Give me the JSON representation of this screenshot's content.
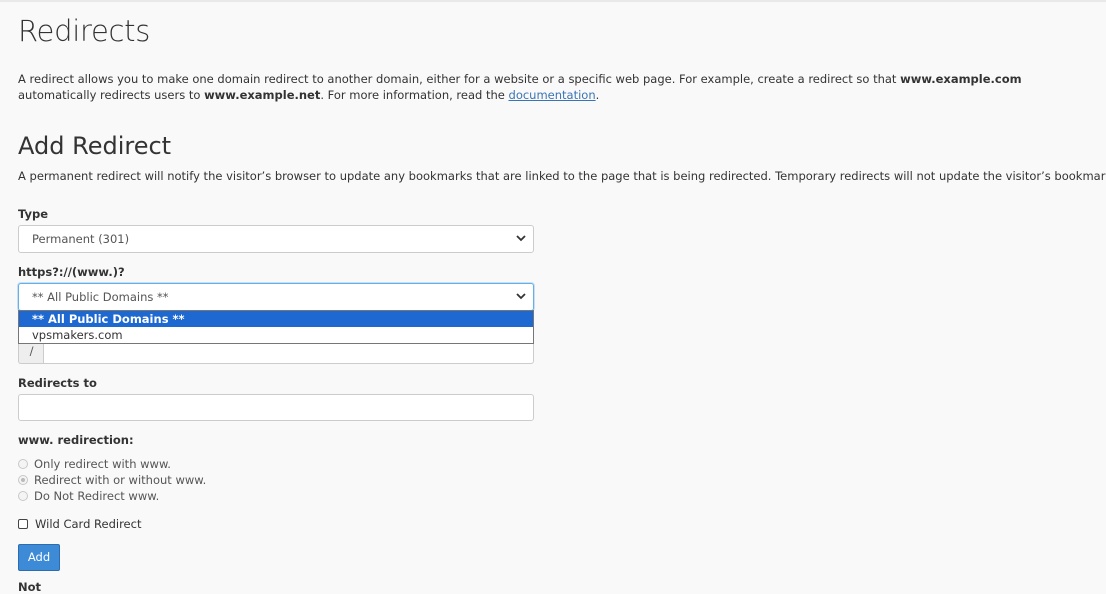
{
  "page": {
    "title": "Redirects",
    "intro": {
      "text1": "A redirect allows you to make one domain redirect to another domain, either for a website or a specific web page. For example, create a redirect so that ",
      "bold1": "www.example.com",
      "text2": " automatically redirects users to ",
      "bold2": "www.example.net",
      "text3": ". For more information, read the ",
      "link": "documentation",
      "text4": "."
    }
  },
  "add_redirect": {
    "title": "Add Redirect",
    "description": "A permanent redirect will notify the visitor’s browser to update any bookmarks that are linked to the page that is being redirected. Temporary redirects will not update the visitor’s bookmarks.",
    "type_label": "Type",
    "type_value": "Permanent (301)",
    "domain_label": "https?://(www.)?",
    "domain_value": "** All Public Domains **",
    "domain_options": [
      "** All Public Domains **",
      "vpsmakers.com"
    ],
    "path_prefix": "/",
    "redirects_to_label": "Redirects to",
    "www_label": "www. redirection:",
    "www_options": [
      "Only redirect with www.",
      "Redirect with or without www.",
      "Do Not Redirect www."
    ],
    "www_selected": "Redirect with or without www.",
    "wildcard_label": "Wild Card Redirect",
    "wildcard_checked": false,
    "add_button": "Add",
    "note_cut": "Not"
  },
  "colors": {
    "accent": "#3d8bd6",
    "link": "#3a74b5",
    "dropdown_selected": "#1e68d1"
  }
}
